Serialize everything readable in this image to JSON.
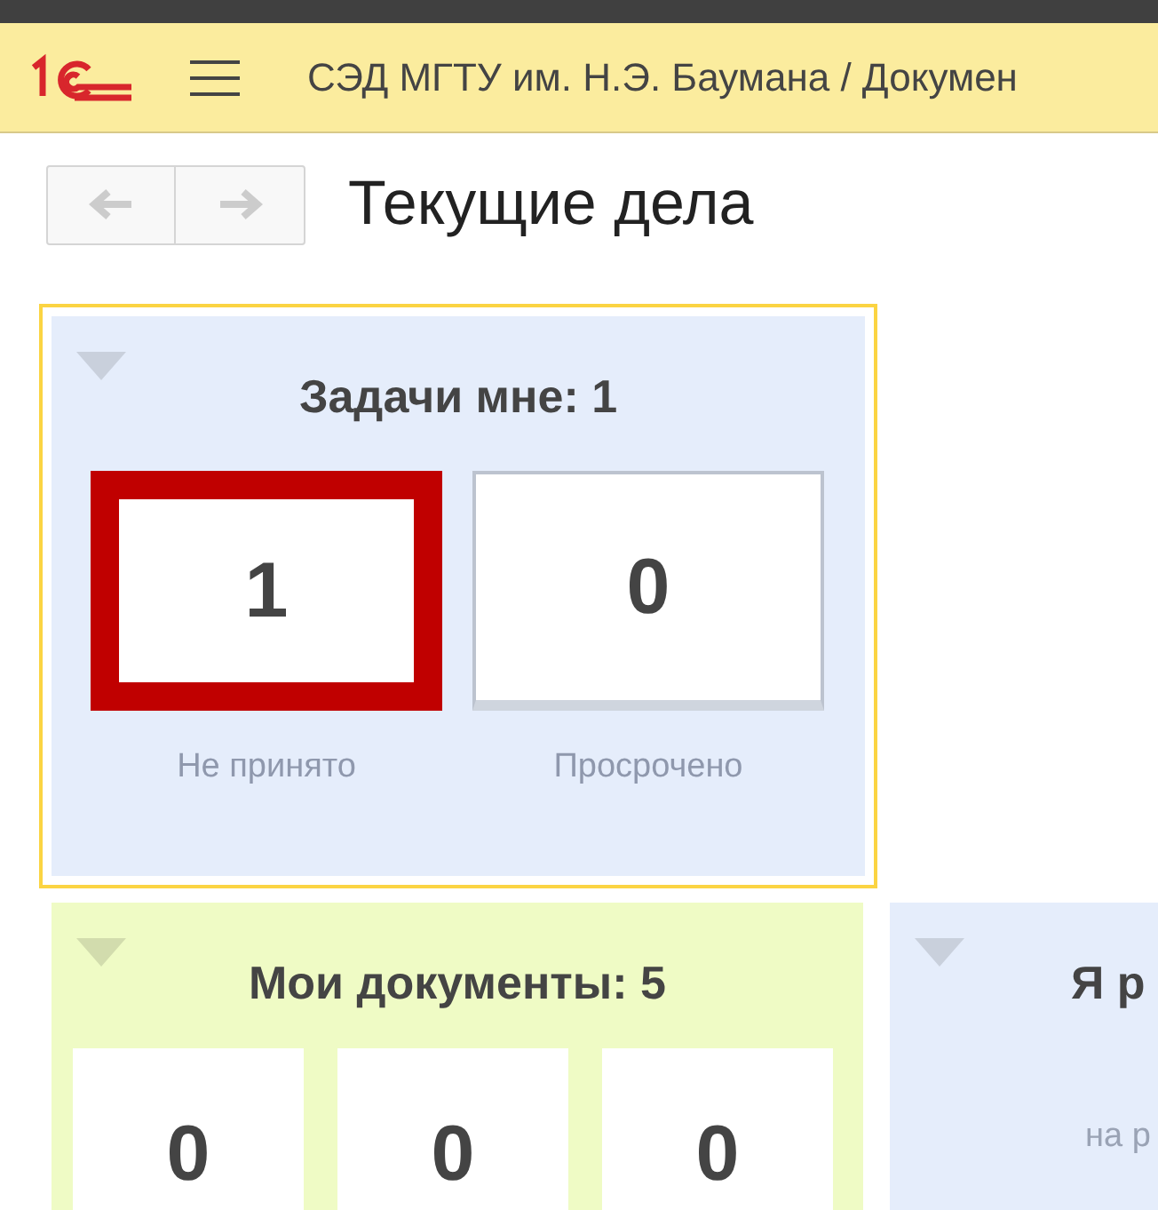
{
  "header": {
    "title": "СЭД МГТУ им. Н.Э. Баумана / Докумен"
  },
  "page": {
    "title": "Текущие дела"
  },
  "panels": [
    {
      "title": "Задачи мне: 1",
      "color": "#e5edfb",
      "focused": true,
      "tiles": [
        {
          "value": "1",
          "label": "Не принято",
          "highlighted": true
        },
        {
          "value": "0",
          "label": "Просрочено",
          "highlighted": false
        }
      ]
    },
    {
      "title": "Мои документы: 5",
      "color": "#effbc5",
      "focused": false,
      "tiles": [
        {
          "value": "0",
          "highlighted": false
        },
        {
          "value": "0",
          "highlighted": false
        },
        {
          "value": "0",
          "highlighted": false
        }
      ]
    },
    {
      "title": "Я р",
      "color": "#e5edfb",
      "focused": false,
      "subtitle": "на р"
    }
  ]
}
